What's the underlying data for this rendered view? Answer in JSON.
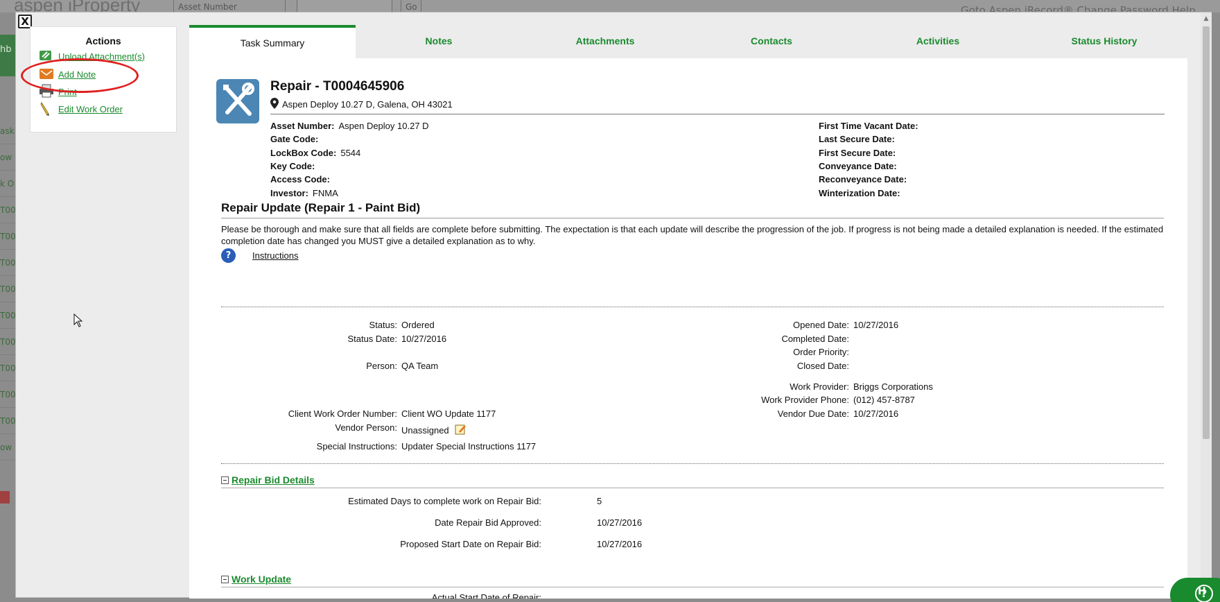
{
  "background": {
    "logo_text": "aspen iProperty",
    "search_select": "Asset Number",
    "go_label": "Go",
    "top_links": "Goto Aspen iRecord®   Change Password   Help",
    "green_tab": "hb",
    "side_letters": [
      "ask",
      "ow",
      "k O",
      "T00",
      "T00",
      "T00",
      "T00",
      "T00",
      "T00",
      "T00",
      "T00",
      "T00",
      "ow"
    ]
  },
  "modal": {
    "close_label": "X",
    "actions": {
      "title": "Actions",
      "items": [
        {
          "label": "Upload Attachment(s)",
          "icon": "paperclip-icon"
        },
        {
          "label": "Add Note",
          "icon": "envelope-icon"
        },
        {
          "label": "Print",
          "icon": "printer-icon"
        },
        {
          "label": "Edit Work Order",
          "icon": "pencil-icon"
        }
      ]
    },
    "tabs": [
      {
        "label": "Task Summary"
      },
      {
        "label": "Notes"
      },
      {
        "label": "Attachments"
      },
      {
        "label": "Contacts"
      },
      {
        "label": "Activities"
      },
      {
        "label": "Status History"
      }
    ],
    "header": {
      "title": "Repair - T0004645906",
      "address": "Aspen Deploy 10.27 D, Galena, OH 43021"
    },
    "asset_left": [
      {
        "label": "Asset Number:",
        "value": "Aspen Deploy 10.27 D"
      },
      {
        "label": "Gate Code:",
        "value": ""
      },
      {
        "label": "LockBox Code:",
        "value": "5544"
      },
      {
        "label": "Key Code:",
        "value": ""
      },
      {
        "label": "Access Code:",
        "value": ""
      },
      {
        "label": "Investor:",
        "value": "FNMA"
      }
    ],
    "asset_right": [
      {
        "label": "First Time Vacant Date:",
        "value": ""
      },
      {
        "label": "Last Secure Date:",
        "value": ""
      },
      {
        "label": "First Secure Date:",
        "value": ""
      },
      {
        "label": "Conveyance Date:",
        "value": ""
      },
      {
        "label": "Reconveyance Date:",
        "value": ""
      },
      {
        "label": "Winterization Date:",
        "value": ""
      }
    ],
    "update": {
      "title": "Repair Update (Repair 1 - Paint Bid)",
      "intro": "Please be thorough and make sure that all fields are complete before submitting. The expectation is that each update will describe the progression of the job. If progress is not being made a detailed explanation is needed. If the estimated completion date has changed you MUST give a detailed explanation as to why.",
      "instructions": "Instructions"
    },
    "details_left": [
      {
        "label": "Status:",
        "value": "Ordered"
      },
      {
        "label": "Status Date:",
        "value": "10/27/2016"
      },
      {
        "label": "Person:",
        "value": "QA Team"
      },
      {
        "label": "Client Work Order Number:",
        "value": "Client WO Update 1177"
      },
      {
        "label": "Vendor Person:",
        "value": "Unassigned"
      },
      {
        "label": "Special Instructions:",
        "value": "Updater Special Instructions 1177"
      }
    ],
    "details_right": [
      {
        "label": "Opened Date:",
        "value": "10/27/2016"
      },
      {
        "label": "Completed Date:",
        "value": ""
      },
      {
        "label": "Order Priority:",
        "value": ""
      },
      {
        "label": "Closed Date:",
        "value": ""
      },
      {
        "label": "Work Provider:",
        "value": "Briggs Corporations"
      },
      {
        "label": "Work Provider Phone:",
        "value": "(012) 457-8787"
      },
      {
        "label": "Vendor Due Date:",
        "value": "10/27/2016"
      }
    ],
    "repair_bid": {
      "title": "Repair Bid Details",
      "rows": [
        {
          "label": "Estimated Days to complete work on Repair Bid:",
          "value": "5"
        },
        {
          "label": "Date Repair Bid Approved:",
          "value": "10/27/2016"
        },
        {
          "label": "Proposed Start Date on Repair Bid:",
          "value": "10/27/2016"
        }
      ]
    },
    "work_update": {
      "title": "Work Update",
      "partial_label": "Actual Start Date of Repair:"
    }
  },
  "help_bubble": {
    "label": "H"
  },
  "colors": {
    "accent": "#1a8a2e",
    "highlight": "#e02020",
    "icon_blue": "#4b86b4"
  }
}
